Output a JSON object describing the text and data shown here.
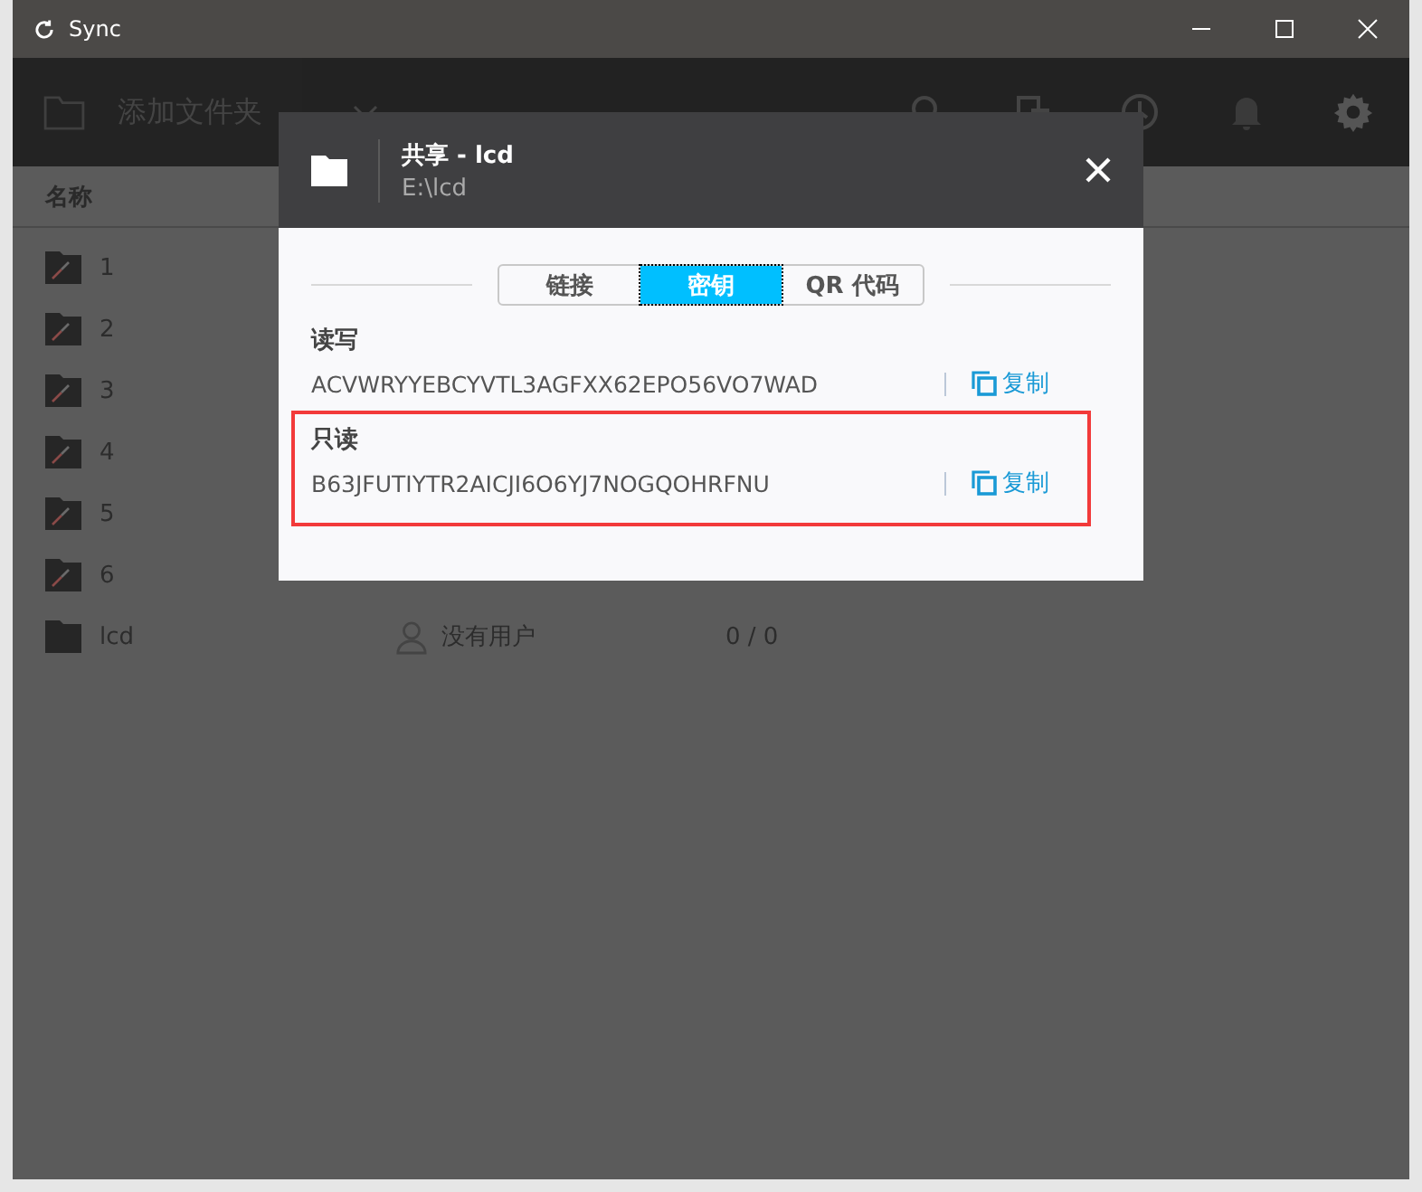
{
  "window": {
    "title": "Sync"
  },
  "toolbar": {
    "add_folder": "添加文件夹"
  },
  "table": {
    "columns": [
      "名称"
    ],
    "rows": [
      {
        "name": "1",
        "kind": "error"
      },
      {
        "name": "2",
        "kind": "error"
      },
      {
        "name": "3",
        "kind": "error"
      },
      {
        "name": "4",
        "kind": "error"
      },
      {
        "name": "5",
        "kind": "error"
      },
      {
        "name": "6",
        "kind": "error"
      },
      {
        "name": "lcd",
        "kind": "plain",
        "users": "没有用户",
        "count": "0 / 0"
      }
    ]
  },
  "dialog": {
    "title": "共享 - lcd",
    "path": "E:\\lcd",
    "tabs": [
      {
        "label": "链接",
        "selected": false
      },
      {
        "label": "密钥",
        "selected": true
      },
      {
        "label": "QR 代码",
        "selected": false
      }
    ],
    "keys": [
      {
        "label": "读写",
        "value": "ACVWRYYEBCYVTL3AGFXX62EPO56VO7WAD",
        "copy": "复制",
        "highlighted": false
      },
      {
        "label": "只读",
        "value": "B63JFUTIYTR2AICJI6O6YJ7NOGQOHRFNU",
        "copy": "复制",
        "highlighted": true
      }
    ]
  }
}
